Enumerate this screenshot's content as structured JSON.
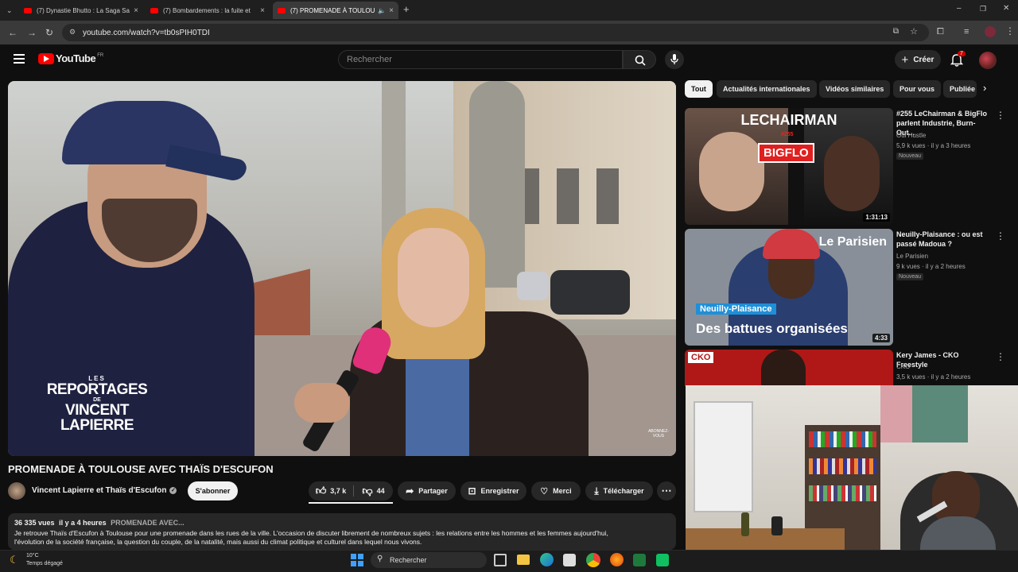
{
  "browser": {
    "tabs": [
      {
        "title": "(7) Dynastie Bhutto : La Saga Sa"
      },
      {
        "title": "(7) Bombardements : la fuite et"
      },
      {
        "title": "(7) PROMENADE À TOULOU"
      }
    ],
    "url": "youtube.com/watch?v=tb0sPIH0TDI"
  },
  "header": {
    "logo": "YouTube",
    "region": "FR",
    "search_placeholder": "Rechercher",
    "create_label": "Créer",
    "notifications_count": "7"
  },
  "video": {
    "overlay_line1": "LES",
    "overlay_line2": "REPORTAGES",
    "overlay_line3": "DE",
    "overlay_line4": "VINCENT LAPIERRE",
    "corner_mark": "ABONNEZ-VOUS",
    "title": "PROMENADE À TOULOUSE AVEC THAÏS D'ESCUFON",
    "channel": "Vincent Lapierre et Thaïs d'Escufon",
    "subscribe_label": "S'abonner",
    "likes": "3,7 k",
    "dislikes": "44",
    "share_label": "Partager",
    "save_label": "Enregistrer",
    "thanks_label": "Merci",
    "download_label": "Télécharger"
  },
  "description": {
    "views": "36 335 vues",
    "age": "il y a 4 heures",
    "tag": "PROMENADE AVEC...",
    "line1": "Je retrouve Thaïs d'Escufon à Toulouse pour une promenade dans les rues de la ville. L'occasion de discuter librement de nombreux sujets : les relations entre les hommes et les femmes aujourd'hui,",
    "line2": "l'évolution de la société française, la question du couple, de la natalité, mais aussi du climat politique et culturel dans lequel nous vivons."
  },
  "chips": [
    "Tout",
    "Actualités internationales",
    "Vidéos similaires",
    "Pour vous",
    "Publiée"
  ],
  "recommendations": [
    {
      "title": "#255 LeChairman & BigFlo parlent Industrie, Burn-Out...",
      "channel": "Oui Hustle",
      "meta": "5,9 k vues · il y a 3 heures",
      "badge": "Nouveau",
      "duration": "1:31:13",
      "thumb_text1": "LECHAIRMAN",
      "thumb_text2": "#255",
      "thumb_text3": "BIGFLO"
    },
    {
      "title": "Neuilly-Plaisance : ou est passé Madoua ?",
      "channel": "Le Parisien",
      "meta": "9 k vues · il y a 2 heures",
      "badge": "Nouveau",
      "duration": "4:33",
      "thumb_text1": "Le Parisien",
      "thumb_text2": "Neuilly-Plaisance",
      "thumb_text3": "Des battues organisées"
    },
    {
      "title": "Kery James - CKO Freestyle",
      "channel": "CKO",
      "meta": "3,5 k vues · il y a 2 heures",
      "thumb_text1": "CKO"
    }
  ],
  "taskbar": {
    "temperature": "10°C",
    "weather": "Temps dégagé",
    "search_label": "Rechercher"
  },
  "colors": {
    "yt_red": "#ff0000",
    "background": "#0f0f0f",
    "chip": "#272727"
  }
}
